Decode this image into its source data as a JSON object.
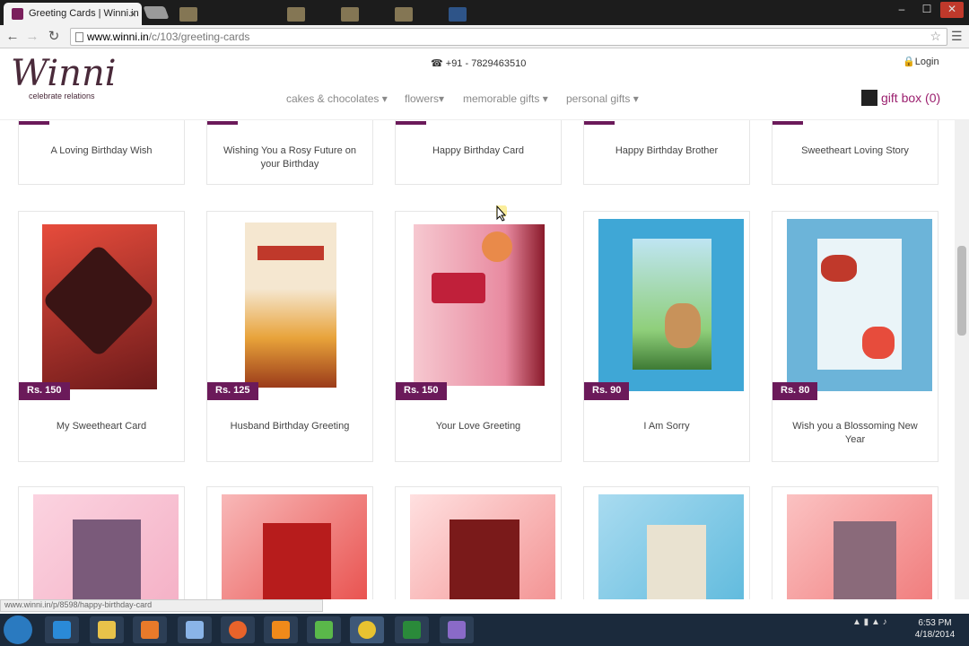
{
  "browser": {
    "tab_title": "Greeting Cards | Winni.in",
    "tab_close": "×",
    "url_prefix": "www.winni.in",
    "url_path": "/c/103/greeting-cards",
    "window_controls": [
      "–",
      "☐",
      "✕"
    ],
    "status_url": "www.winni.in/p/8598/happy-birthday-card"
  },
  "header": {
    "logo_text": "Winni",
    "logo_tagline": "celebrate relations",
    "phone": "+91 - 7829463510",
    "login": "Login",
    "nav": [
      "cakes & chocolates",
      "flowers",
      "memorable gifts",
      "personal gifts"
    ],
    "gift_box": "gift box (0)"
  },
  "row1": [
    {
      "title": "A Loving Birthday Wish"
    },
    {
      "title": "Wishing You a Rosy Future on your Birthday"
    },
    {
      "title": "Happy Birthday Card"
    },
    {
      "title": "Happy Birthday Brother"
    },
    {
      "title": "Sweetheart Loving Story"
    }
  ],
  "row2": [
    {
      "title": "My Sweetheart Card",
      "price": "Rs. 150",
      "color": "#c0392b"
    },
    {
      "title": "Husband Birthday Greeting",
      "price": "Rs. 125",
      "color": "#e8a33a"
    },
    {
      "title": "Your Love Greeting",
      "price": "Rs. 150",
      "color": "#e88aa0"
    },
    {
      "title": "I Am Sorry",
      "price": "Rs. 90",
      "color": "#3fa7d6"
    },
    {
      "title": "Wish you a Blossoming New Year",
      "price": "Rs. 80",
      "color": "#6cb4d9"
    }
  ],
  "row3": [
    {
      "color": "#f3a9c0"
    },
    {
      "color": "#e53935"
    },
    {
      "color": "#f08080"
    },
    {
      "color": "#4fb3d9"
    },
    {
      "color": "#ee6b6b"
    }
  ],
  "taskbar": {
    "clock_time": "6:53 PM",
    "clock_date": "4/18/2014"
  }
}
